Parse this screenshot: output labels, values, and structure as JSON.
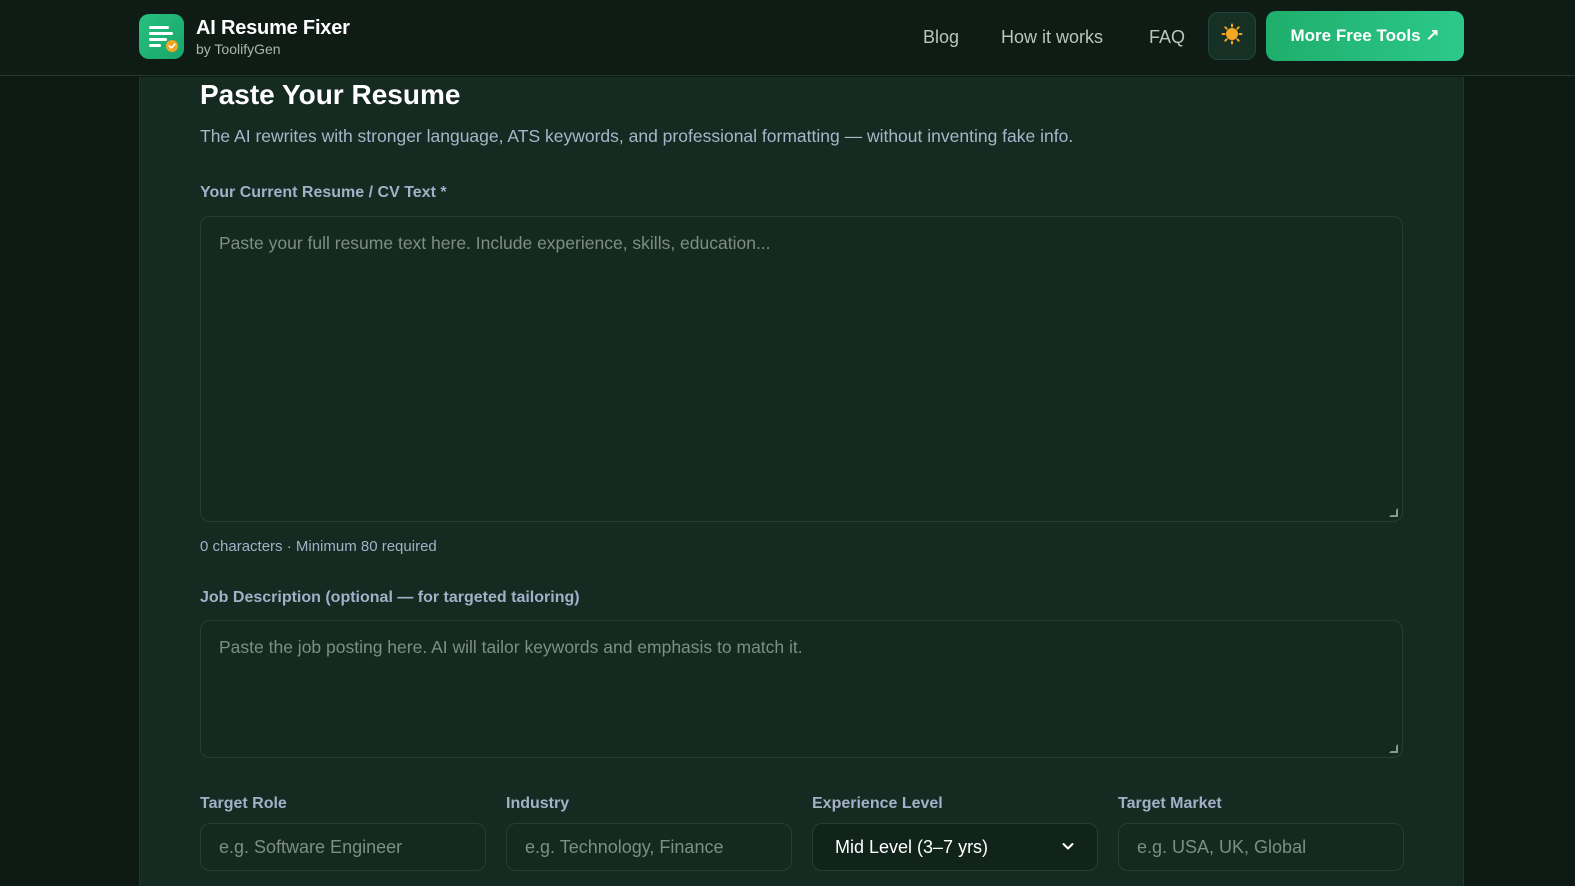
{
  "header": {
    "brand_title": "AI Resume Fixer",
    "brand_subtitle": "by ToolifyGen",
    "nav": {
      "blog": "Blog",
      "how_it_works": "How it works",
      "faq": "FAQ"
    },
    "theme_icon": "sun-icon",
    "cta_label": "More Free Tools ↗"
  },
  "main": {
    "title": "Paste Your Resume",
    "subtitle": "The AI rewrites with stronger language, ATS keywords, and professional formatting — without inventing fake info.",
    "resume": {
      "label": "Your Current Resume / CV Text *",
      "placeholder": "Paste your full resume text here. Include experience, skills, education...",
      "value": "",
      "char_count": "0 characters · Minimum 80 required"
    },
    "job_description": {
      "label": "Job Description (optional — for targeted tailoring)",
      "placeholder": "Paste the job posting here. AI will tailor keywords and emphasis to match it.",
      "value": ""
    },
    "fields": {
      "target_role": {
        "label": "Target Role",
        "placeholder": "e.g. Software Engineer",
        "value": ""
      },
      "industry": {
        "label": "Industry",
        "placeholder": "e.g. Technology, Finance",
        "value": ""
      },
      "experience_level": {
        "label": "Experience Level",
        "selected": "Mid Level (3–7 yrs)"
      },
      "target_market": {
        "label": "Target Market",
        "placeholder": "e.g. USA, UK, Global",
        "value": ""
      }
    }
  },
  "colors": {
    "accent": "#22b877",
    "background": "#0d1a14",
    "card": "#152a20",
    "label": "#a3b0c8"
  }
}
